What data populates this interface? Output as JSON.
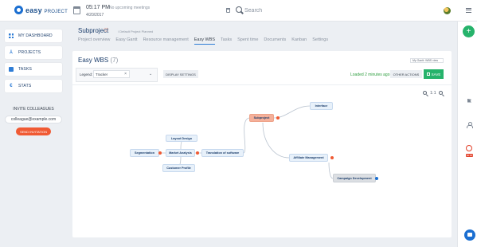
{
  "header": {
    "brand": "easy",
    "brand_suffix": "PROJECT",
    "time": "05:17 PM",
    "meeting_text": "No upcoming meetings",
    "date": "4/20/2017",
    "search_placeholder": "Search"
  },
  "sidebar": {
    "items": [
      {
        "label": "MY DASHBOARD",
        "icon": "dashboard-icon"
      },
      {
        "label": "PROJECTS",
        "icon": "projects-icon"
      },
      {
        "label": "TASKS",
        "icon": "tasks-icon"
      },
      {
        "label": "STATS",
        "icon": "stats-icon"
      }
    ],
    "invite": {
      "title": "INVITE COLLEAGUES",
      "input_value": "colleague@example.com",
      "button_label": "SEND INVITATION"
    }
  },
  "page": {
    "title": "Subproject",
    "breadcrumb": "/ Default Project   Planned",
    "tabs": [
      "Project overview",
      "Easy Gantt",
      "Resource management",
      "Easy WBS",
      "Tasks",
      "Spent time",
      "Documents",
      "Kanban",
      "Settings"
    ],
    "active_tab": "Easy WBS"
  },
  "wbs": {
    "title": "Easy WBS",
    "count": "(7)",
    "view_select": "My Gantt: WBS view",
    "legend_label": "Legend:",
    "legend_value": "Tracker",
    "display_settings": "DISPLAY SETTINGS",
    "loaded_text": "Loaded 2 minutes ago",
    "other_actions": "OTHER ACTIONS",
    "save_label": "SAVE",
    "zoom_label": "1:1",
    "nodes": {
      "subproject": "Subproject",
      "interface": "Interface",
      "affiliate": "Affiliate Management",
      "campaign": "Campaign Development",
      "translation": "Translation of software",
      "layout": "Layout Design",
      "segmentation": "Segmentation",
      "market": "Market Analysis",
      "customer": "Customer Profile"
    }
  },
  "rail": {
    "plus_label": "+",
    "timer_badge": "00:00"
  },
  "colors": {
    "accent_blue": "#1b6fd1",
    "save_green": "#26b36b",
    "invite_orange": "#f05a33",
    "root_node": "#f5b09a"
  }
}
